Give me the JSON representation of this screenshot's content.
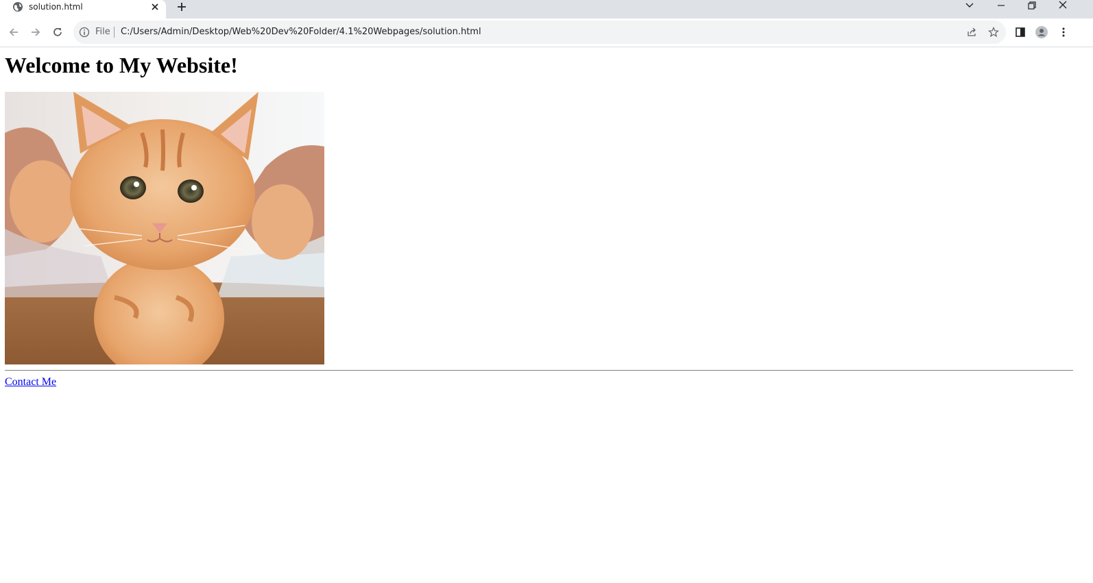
{
  "browser": {
    "tab": {
      "title": "solution.html",
      "favicon": "globe-icon"
    },
    "address_bar": {
      "scheme_label": "File",
      "url": "C:/Users/Admin/Desktop/Web%20Dev%20Folder/4.1%20Webpages/solution.html"
    },
    "icons": [
      "back-icon",
      "forward-icon",
      "reload-icon",
      "info-icon",
      "share-icon",
      "star-icon",
      "side-panel-icon",
      "profile-icon",
      "menu-icon",
      "tab-search-icon",
      "minimize-icon",
      "restore-icon",
      "close-icon",
      "new-tab-icon"
    ]
  },
  "page": {
    "heading": "Welcome to My Website!",
    "image": {
      "alt": "kitten",
      "subject": "orange tabby kitten held by hands"
    },
    "contact_link": "Contact Me"
  },
  "colors": {
    "tabstrip_bg": "#dee1e6",
    "omnibox_bg": "#f1f3f4",
    "link": "#0000ee"
  }
}
